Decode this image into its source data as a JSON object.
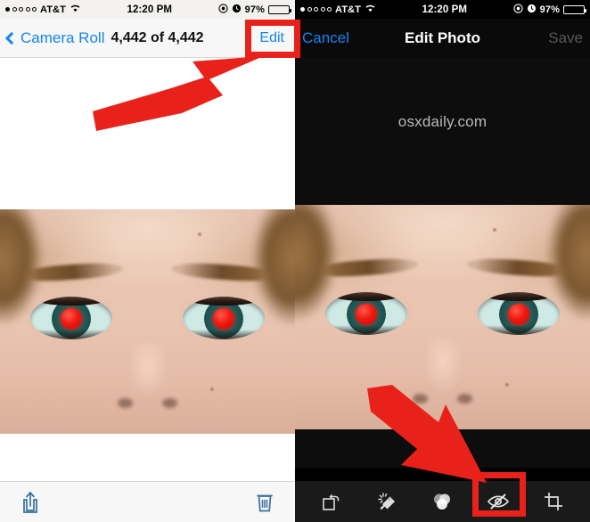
{
  "meta": {
    "watermark": "osxdaily.com",
    "accent_blue": "#1485ee",
    "annotation_red": "#e8221a",
    "dark_bg": "#0d0d0d",
    "light_bg": "#f7f7f7"
  },
  "status_bar": {
    "carrier": "AT&T",
    "signal_dots_total": 5,
    "signal_dots_filled": 1,
    "wifi_icon": "wifi-icon",
    "time": "12:20 PM",
    "location_icon": "location-arrow-icon",
    "alarm_icon": "alarm-clock-icon",
    "battery_percent": "97%",
    "battery_level": 97
  },
  "left_panel": {
    "nav": {
      "back_icon": "chevron-left-icon",
      "back_label": "Camera Roll",
      "count_label": "4,442 of 4,442",
      "edit_label": "Edit"
    },
    "toolbar": {
      "share_icon": "share-icon",
      "trash_icon": "trash-icon"
    },
    "annotation": {
      "highlight_target": "Edit",
      "arrow_icon": "arrow-pointing-up-right-icon",
      "box_color": "#e8221a"
    }
  },
  "right_panel": {
    "nav": {
      "cancel_label": "Cancel",
      "title": "Edit Photo",
      "save_label": "Save",
      "save_disabled": true
    },
    "toolbar": {
      "items": [
        {
          "label": "Rotate",
          "icon": "rotate-icon",
          "selected": false
        },
        {
          "label": "Auto Enhance",
          "icon": "magic-wand-icon",
          "selected": false
        },
        {
          "label": "Filters",
          "icon": "filters-circles-icon",
          "selected": false
        },
        {
          "label": "Red-Eye",
          "icon": "red-eye-crossed-icon",
          "selected": true
        },
        {
          "label": "Crop",
          "icon": "crop-icon",
          "selected": false
        }
      ]
    },
    "annotation": {
      "highlight_target": "Red-Eye",
      "arrow_icon": "arrow-pointing-down-right-icon",
      "box_color": "#e8221a"
    }
  },
  "photo": {
    "subject": "close-up of a face showing red-eye effect in both eyes",
    "red_eye_color": "#f01a10",
    "iris_color": "#1f5654",
    "sclera_color": "#cfe9e4"
  }
}
